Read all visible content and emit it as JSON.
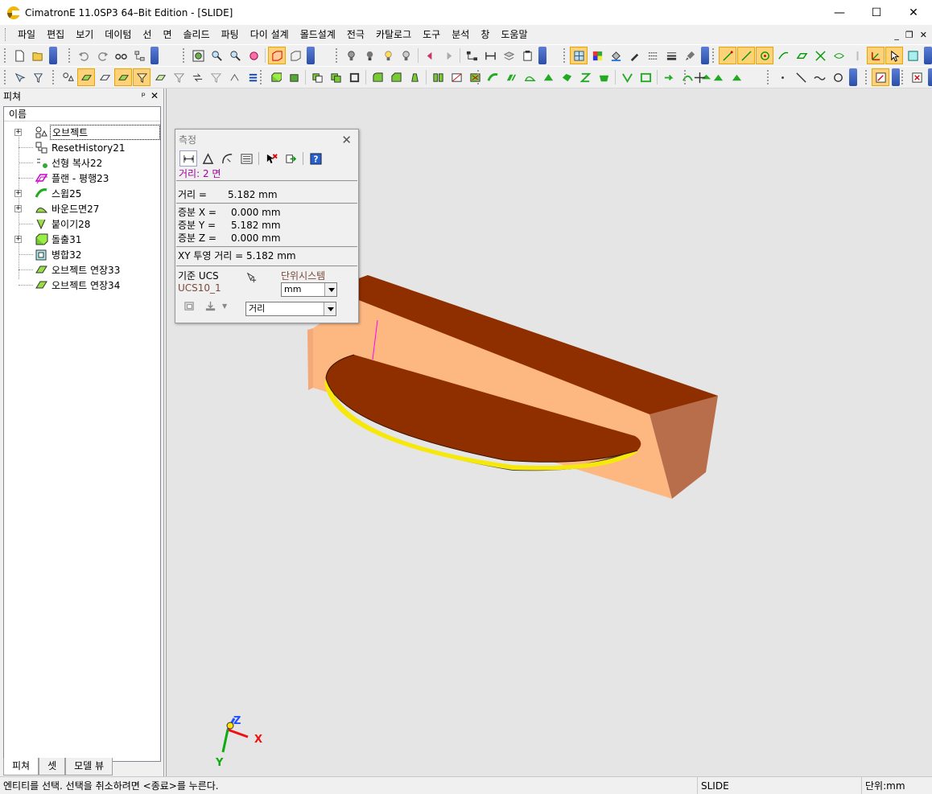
{
  "window": {
    "title": "CimatronE 11.0SP3 64–Bit Edition - [SLIDE]",
    "minimize": "—",
    "maximize": "☐",
    "close": "✕"
  },
  "menu": [
    "파일",
    "편집",
    "보기",
    "데이텀",
    "선",
    "면",
    "솔리드",
    "파팅",
    "다이 설계",
    "몰드설계",
    "전극",
    "카탈로그",
    "도구",
    "분석",
    "창",
    "도움말"
  ],
  "mdi": {
    "minimize": "_",
    "restore": "❐",
    "close": "✕"
  },
  "feature_panel": {
    "title": "피쳐",
    "pin": "ᵖ",
    "close": "✕",
    "column": "이름",
    "tree": [
      {
        "label": "오브젝트",
        "expandable": true,
        "icon": "object-icon",
        "selected": true
      },
      {
        "label": "ResetHistory21",
        "expandable": false,
        "icon": "reset-history-icon"
      },
      {
        "label": "선형 복사22",
        "expandable": false,
        "icon": "linear-copy-icon"
      },
      {
        "label": "플랜 - 평행23",
        "expandable": false,
        "icon": "plane-parallel-icon"
      },
      {
        "label": "스윕25",
        "expandable": true,
        "icon": "sweep-icon"
      },
      {
        "label": "바운드면27",
        "expandable": true,
        "icon": "bounded-face-icon"
      },
      {
        "label": "붙이기28",
        "expandable": false,
        "icon": "attach-icon"
      },
      {
        "label": "돌출31",
        "expandable": true,
        "icon": "extrude-icon"
      },
      {
        "label": "병합32",
        "expandable": false,
        "icon": "merge-icon"
      },
      {
        "label": "오브젝트 연장33",
        "expandable": false,
        "icon": "object-extend-icon"
      },
      {
        "label": "오브젝트 연장34",
        "expandable": false,
        "icon": "object-extend-icon"
      }
    ],
    "tabs": [
      "피쳐",
      "셋",
      "모델 뷰"
    ]
  },
  "measure_dialog": {
    "title": "측정",
    "close": "✕",
    "mode": "거리:  2 면",
    "distance_label": "거리 =",
    "distance_value": "5.182 mm",
    "dx_label": "증분 X =",
    "dx_value": "0.000 mm",
    "dy_label": "증분 Y =",
    "dy_value": "5.182 mm",
    "dz_label": "증분 Z =",
    "dz_value": "0.000 mm",
    "xy_projection": "XY 투영 거리 = 5.182 mm",
    "ucs_label": "기준 UCS",
    "ucs_value": "UCS10_1",
    "unit_system_label": "단위시스템",
    "unit_value": "mm",
    "measure_type": "거리"
  },
  "axis": {
    "x": "X",
    "y": "Y",
    "z": "Z"
  },
  "status": {
    "prompt": "엔티티를 선택. 선택을 취소하려면 <종료>를 누른다.",
    "file": "SLIDE",
    "unit": "단위:mm"
  },
  "colors": {
    "viewport_bg": "#e5e5e5",
    "model_top": "#8f2f00",
    "model_side": "#fdb882",
    "model_dark_side": "#b86e4a",
    "highlight_yellow": "#f5e80a",
    "measure_line": "#ff00ff"
  }
}
